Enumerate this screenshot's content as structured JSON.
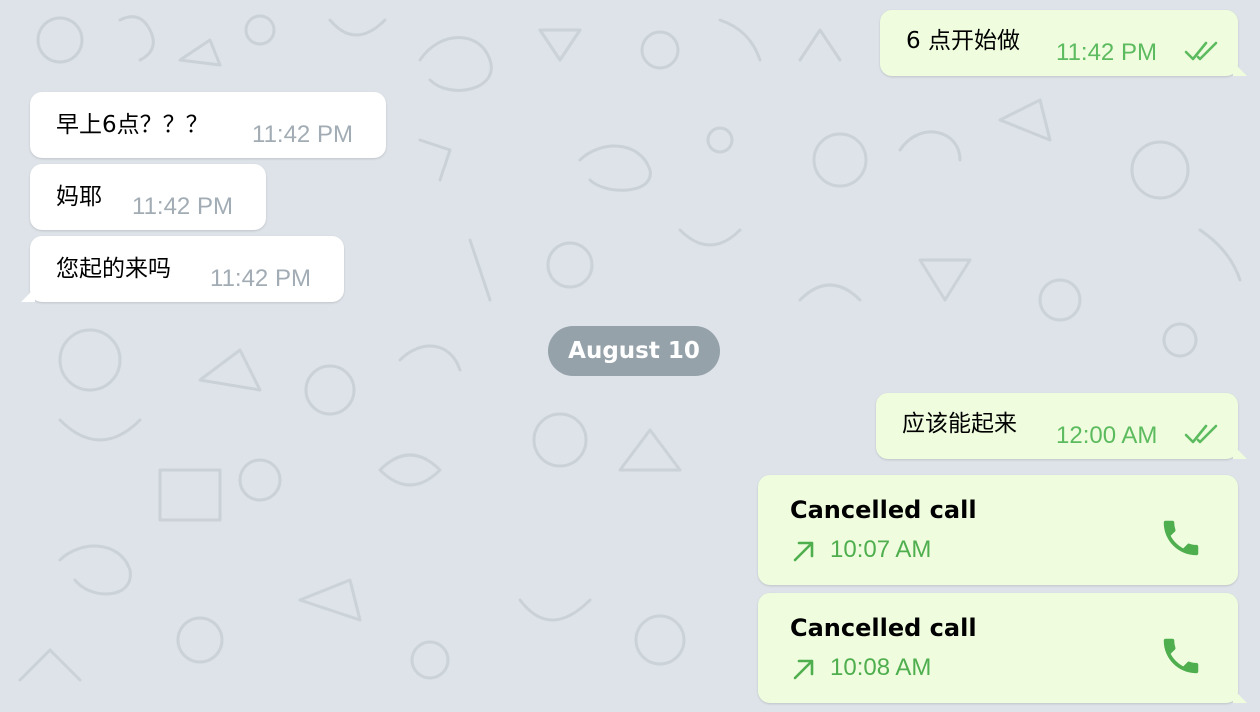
{
  "chat": {
    "messages": [
      {
        "text": "6 点开始做",
        "time": "11:42 PM",
        "direction": "outgoing",
        "status_icon": "double-check-icon"
      },
      {
        "text": "早上6点？？？",
        "time": "11:42 PM",
        "direction": "incoming"
      },
      {
        "text": "妈耶",
        "time": "11:42 PM",
        "direction": "incoming"
      },
      {
        "text": "您起的来吗",
        "time": "11:42 PM",
        "direction": "incoming"
      }
    ],
    "date_separator": "August 10",
    "messages_after": [
      {
        "text": "应该能起来",
        "time": "12:00 AM",
        "direction": "outgoing",
        "status_icon": "double-check-icon"
      }
    ],
    "calls": [
      {
        "title": "Cancelled call",
        "time": "10:07 AM",
        "direction_icon": "outgoing-arrow-icon",
        "action_icon": "phone-icon"
      },
      {
        "title": "Cancelled call",
        "time": "10:08 AM",
        "direction_icon": "outgoing-arrow-icon",
        "action_icon": "phone-icon"
      }
    ]
  },
  "colors": {
    "wallpaper": "#dde3e8",
    "incoming_bubble": "#ffffff",
    "outgoing_bubble": "#effdde",
    "outgoing_accent": "#4fae4e",
    "incoming_time": "#a2acb4",
    "date_pill": "#808f99"
  }
}
